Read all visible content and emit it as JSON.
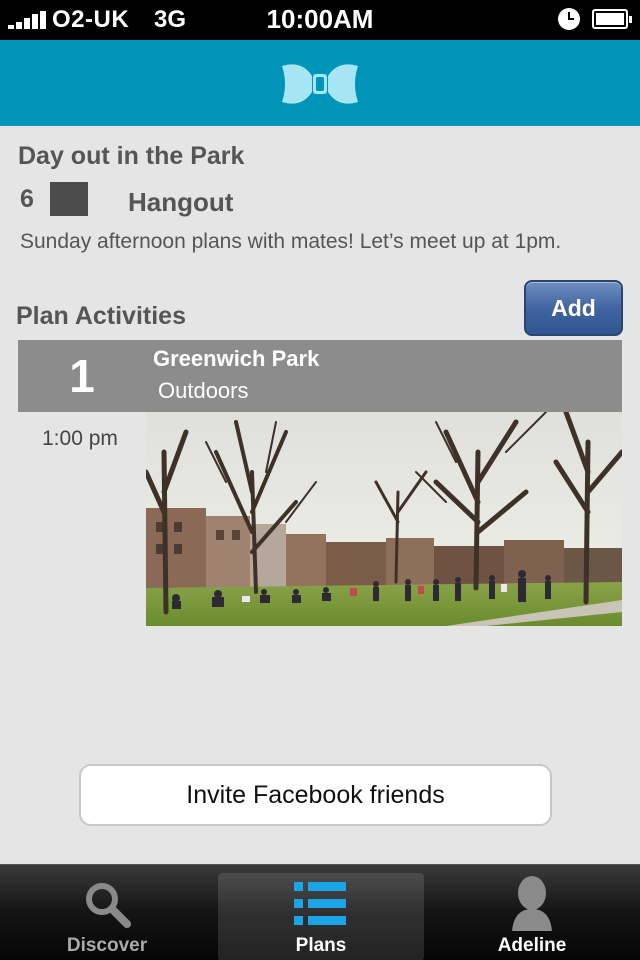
{
  "status_bar": {
    "carrier": "O2-UK",
    "network": "3G",
    "time": "10:00AM",
    "icons": [
      "signal-icon",
      "clock-icon",
      "battery-icon"
    ]
  },
  "header": {
    "logo": "bow-tie-logo",
    "brand_color": "#0194b9"
  },
  "plan": {
    "title": "Day out in the Park",
    "guest_count": "6",
    "swatch_color": "#4c4c4c",
    "type": "Hangout",
    "description": "Sunday afternoon plans with mates! Let’s meet up at 1pm."
  },
  "activities_section": {
    "title": "Plan Activities",
    "add_label": "Add",
    "items": [
      {
        "number": "1",
        "name": "Greenwich Park",
        "category": "Outdoors",
        "time": "1:00 pm",
        "photo": "park-photo"
      }
    ]
  },
  "invite_button": {
    "label": "Invite Facebook friends"
  },
  "tab_bar": {
    "tabs": [
      {
        "label": "Discover",
        "icon": "search-icon"
      },
      {
        "label": "Plans",
        "icon": "list-icon",
        "selected": true
      },
      {
        "label": "Adeline",
        "icon": "person-icon"
      }
    ],
    "active_color": "#1aa6e6"
  }
}
